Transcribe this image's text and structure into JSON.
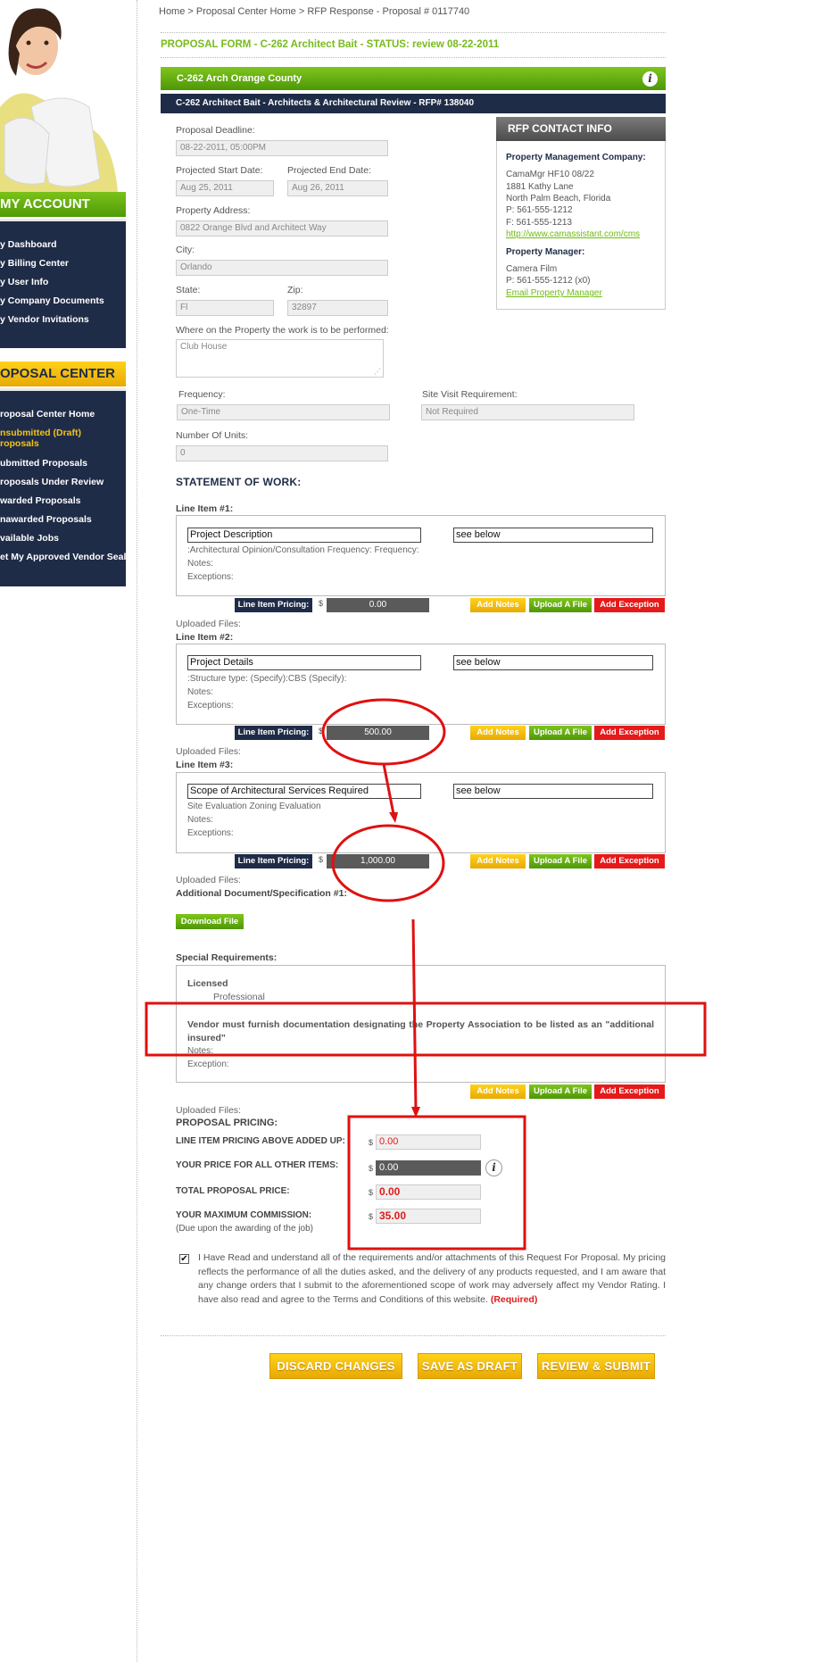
{
  "breadcrumb": {
    "home": "Home",
    "sep1": ">",
    "proposal_center": "Proposal Center Home",
    "sep2": ">",
    "current": "RFP Response - Proposal # 0117740"
  },
  "form_title": "PROPOSAL FORM - C-262 Architect Bait - STATUS: review 08-22-2011",
  "green_bar_title": "C-262 Arch Orange County",
  "info_icon_glyph": "i",
  "navy_bar_title": "C-262 Architect Bait - Architects & Architectural Review - RFP# 138040",
  "sidebar": {
    "account_header": "MY ACCOUNT",
    "account_items": [
      "y Dashboard",
      "y Billing Center",
      "y User Info",
      "y Company Documents",
      "y Vendor Invitations"
    ],
    "proposal_header": "OPOSAL CENTER",
    "proposal_items": [
      {
        "label": "roposal Center Home"
      },
      {
        "label": "nsubmitted (Draft)",
        "label2": "roposals"
      },
      {
        "label": "ubmitted Proposals"
      },
      {
        "label": "roposals Under Review"
      },
      {
        "label": "warded Proposals"
      },
      {
        "label": "nawarded Proposals"
      },
      {
        "label": "vailable Jobs"
      },
      {
        "label": "et My Approved Vendor Seal"
      }
    ]
  },
  "fields": {
    "deadline_label": "Proposal Deadline:",
    "deadline_value": "08-22-2011, 05:00PM",
    "start_label": "Projected Start Date:",
    "start_value": "Aug 25, 2011",
    "end_label": "Projected End Date:",
    "end_value": "Aug 26, 2011",
    "address_label": "Property Address:",
    "address_value": "0822 Orange Blvd and Architect Way",
    "city_label": "City:",
    "city_value": "Orlando",
    "state_label": "State:",
    "state_value": "Fl",
    "zip_label": "Zip:",
    "zip_value": "32897",
    "where_label": "Where on the Property the work is to be performed:",
    "where_value": "Club House",
    "frequency_label": "Frequency:",
    "frequency_value": "One-Time",
    "site_visit_label": "Site Visit Requirement:",
    "site_visit_value": "Not Required",
    "units_label": "Number Of Units:",
    "units_value": "0"
  },
  "contact": {
    "header": "RFP CONTACT INFO",
    "pm_company_label": "Property Management Company:",
    "company_name": "CamaMgr HF10 08/22",
    "street": "1881 Kathy Lane",
    "city_state": "North Palm Beach, Florida",
    "phone": "P: 561-555-1212",
    "fax": "F: 561-555-1213",
    "url": "http://www.camassistant.com/cms",
    "manager_label": "Property Manager:",
    "manager_name": "Camera Film",
    "manager_phone": "P: 561-555-1212 (x0)",
    "email_link": "Email Property Manager"
  },
  "statement_title": "STATEMENT OF WORK:",
  "line_items": [
    {
      "title": "Line Item #1:",
      "name": "Project Description",
      "value": "see below",
      "detail": ":Architectural Opinion/Consultation Frequency: Frequency:",
      "notes": "Notes:",
      "exceptions": "Exceptions:",
      "price": "0.00",
      "uploaded": "Uploaded Files:"
    },
    {
      "title": "Line Item #2:",
      "name": "Project Details",
      "value": "see below",
      "detail": ":Structure type: (Specify):CBS (Specify):",
      "notes": "Notes:",
      "exceptions": "Exceptions:",
      "price": "500.00",
      "uploaded": "Uploaded Files:"
    },
    {
      "title": "Line Item #3:",
      "name": "Scope of Architectural Services Required",
      "value": "see below",
      "detail": "Site Evaluation Zoning Evaluation",
      "notes": "Notes:",
      "exceptions": "Exceptions:",
      "price": "1,000.00",
      "uploaded": "Uploaded Files:"
    }
  ],
  "pricing_label": "Line Item Pricing:",
  "dollar_sign": "$",
  "buttons": {
    "add_notes": "Add Notes",
    "upload_file": "Upload A File",
    "add_exception": "Add Exception",
    "download_file": "Download File",
    "discard": "DISCARD CHANGES",
    "save_draft": "SAVE AS DRAFT",
    "review_submit": "REVIEW & SUBMIT"
  },
  "additional_doc_title": "Additional Document/Specification #1:",
  "special": {
    "title": "Special Requirements:",
    "licensed": "Licensed",
    "professional": "Professional",
    "insured_text": "Vendor must furnish documentation designating the Property Association to be listed as an \"additional insured\"",
    "notes": "Notes:",
    "exception": "Exception:",
    "uploaded": "Uploaded Files:"
  },
  "proposal_pricing": {
    "title": "PROPOSAL PRICING:",
    "line_item_label": "LINE ITEM PRICING ABOVE ADDED UP:",
    "line_item_value": "0.00",
    "other_items_label": "YOUR PRICE FOR ALL OTHER ITEMS:",
    "other_items_value": "0.00",
    "total_label": "TOTAL PROPOSAL PRICE:",
    "total_value": "0.00",
    "commission_label": "YOUR MAXIMUM COMMISSION:",
    "commission_sub": "(Due upon the awarding of the job)",
    "commission_value": "35.00"
  },
  "agreement": {
    "checked_glyph": "✔",
    "text": "I Have Read and understand all of the requirements and/or attachments of this Request For Proposal. My pricing reflects the performance of all the duties asked, and the delivery of any products requested, and I am aware that any change orders that I submit to the aforementioned scope of work may adversely affect my Vendor Rating. I have also read and agree to the Terms and Conditions of this website.",
    "required": "(Required)"
  },
  "colors": {
    "navy": "#1f2c47",
    "green": "#6fbb12",
    "yellow": "#f2c21b",
    "red": "#e61a1a",
    "annotation_red": "#e01010"
  }
}
